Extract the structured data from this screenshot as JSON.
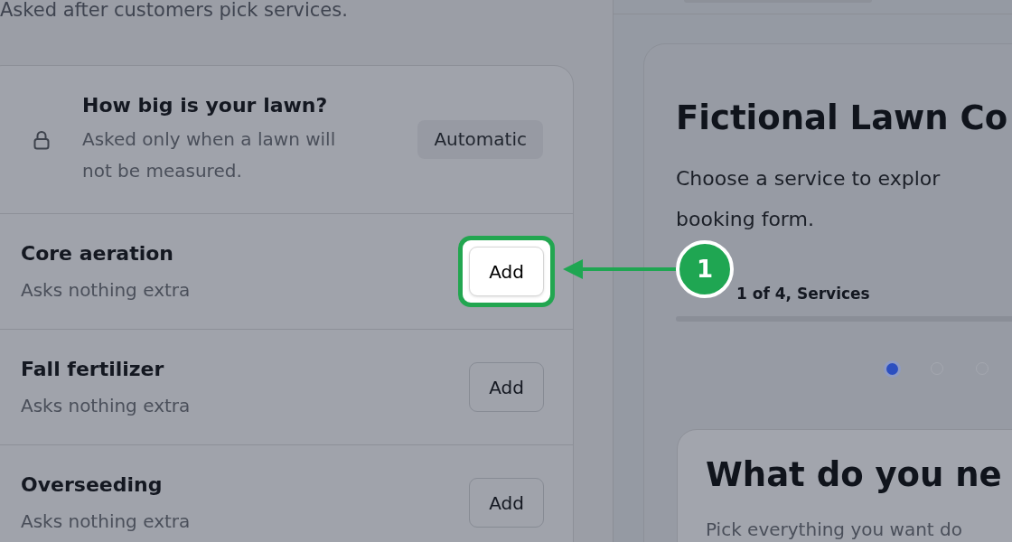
{
  "services_note": "Asked after customers pick services.",
  "questions": {
    "rows": [
      {
        "kind": "locked",
        "title": "How big is your lawn?",
        "description": "Asked only when a lawn will not be measured.",
        "badge": "Automatic"
      },
      {
        "kind": "service",
        "title": "Core aeration",
        "description": "Asks nothing extra",
        "button": "Add",
        "highlighted": true
      },
      {
        "kind": "service",
        "title": "Fall fertilizer",
        "description": "Asks nothing extra",
        "button": "Add",
        "highlighted": false
      },
      {
        "kind": "service",
        "title": "Overseeding",
        "description": "Asks nothing extra",
        "button": "Add",
        "highlighted": false
      }
    ]
  },
  "preview": {
    "title": "Fictional Lawn Co",
    "intro": [
      "Choose a service to explor",
      "booking form."
    ],
    "progress_label": "1 of 4, Services",
    "step_dots": [
      {
        "selected": true
      },
      {
        "selected": false
      },
      {
        "selected": false
      }
    ],
    "form_card": {
      "heading": "What do you ne",
      "subheading": "Pick everything you want do"
    }
  },
  "callout": {
    "number": "1"
  }
}
